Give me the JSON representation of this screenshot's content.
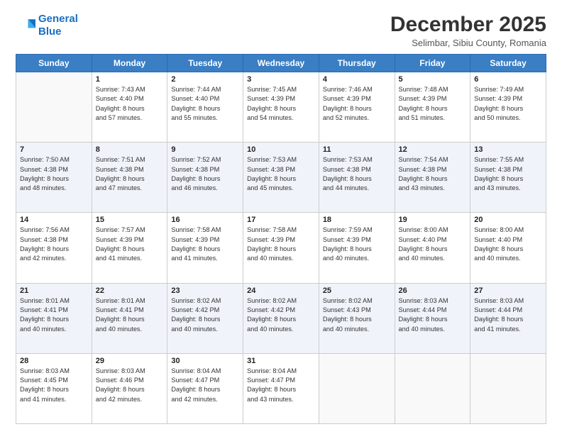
{
  "header": {
    "logo_line1": "General",
    "logo_line2": "Blue",
    "month_title": "December 2025",
    "location": "Selimbar, Sibiu County, Romania"
  },
  "days_of_week": [
    "Sunday",
    "Monday",
    "Tuesday",
    "Wednesday",
    "Thursday",
    "Friday",
    "Saturday"
  ],
  "weeks": [
    [
      {
        "day": "",
        "info": ""
      },
      {
        "day": "1",
        "info": "Sunrise: 7:43 AM\nSunset: 4:40 PM\nDaylight: 8 hours\nand 57 minutes."
      },
      {
        "day": "2",
        "info": "Sunrise: 7:44 AM\nSunset: 4:40 PM\nDaylight: 8 hours\nand 55 minutes."
      },
      {
        "day": "3",
        "info": "Sunrise: 7:45 AM\nSunset: 4:39 PM\nDaylight: 8 hours\nand 54 minutes."
      },
      {
        "day": "4",
        "info": "Sunrise: 7:46 AM\nSunset: 4:39 PM\nDaylight: 8 hours\nand 52 minutes."
      },
      {
        "day": "5",
        "info": "Sunrise: 7:48 AM\nSunset: 4:39 PM\nDaylight: 8 hours\nand 51 minutes."
      },
      {
        "day": "6",
        "info": "Sunrise: 7:49 AM\nSunset: 4:39 PM\nDaylight: 8 hours\nand 50 minutes."
      }
    ],
    [
      {
        "day": "7",
        "info": "Sunrise: 7:50 AM\nSunset: 4:38 PM\nDaylight: 8 hours\nand 48 minutes."
      },
      {
        "day": "8",
        "info": "Sunrise: 7:51 AM\nSunset: 4:38 PM\nDaylight: 8 hours\nand 47 minutes."
      },
      {
        "day": "9",
        "info": "Sunrise: 7:52 AM\nSunset: 4:38 PM\nDaylight: 8 hours\nand 46 minutes."
      },
      {
        "day": "10",
        "info": "Sunrise: 7:53 AM\nSunset: 4:38 PM\nDaylight: 8 hours\nand 45 minutes."
      },
      {
        "day": "11",
        "info": "Sunrise: 7:53 AM\nSunset: 4:38 PM\nDaylight: 8 hours\nand 44 minutes."
      },
      {
        "day": "12",
        "info": "Sunrise: 7:54 AM\nSunset: 4:38 PM\nDaylight: 8 hours\nand 43 minutes."
      },
      {
        "day": "13",
        "info": "Sunrise: 7:55 AM\nSunset: 4:38 PM\nDaylight: 8 hours\nand 43 minutes."
      }
    ],
    [
      {
        "day": "14",
        "info": "Sunrise: 7:56 AM\nSunset: 4:38 PM\nDaylight: 8 hours\nand 42 minutes."
      },
      {
        "day": "15",
        "info": "Sunrise: 7:57 AM\nSunset: 4:39 PM\nDaylight: 8 hours\nand 41 minutes."
      },
      {
        "day": "16",
        "info": "Sunrise: 7:58 AM\nSunset: 4:39 PM\nDaylight: 8 hours\nand 41 minutes."
      },
      {
        "day": "17",
        "info": "Sunrise: 7:58 AM\nSunset: 4:39 PM\nDaylight: 8 hours\nand 40 minutes."
      },
      {
        "day": "18",
        "info": "Sunrise: 7:59 AM\nSunset: 4:39 PM\nDaylight: 8 hours\nand 40 minutes."
      },
      {
        "day": "19",
        "info": "Sunrise: 8:00 AM\nSunset: 4:40 PM\nDaylight: 8 hours\nand 40 minutes."
      },
      {
        "day": "20",
        "info": "Sunrise: 8:00 AM\nSunset: 4:40 PM\nDaylight: 8 hours\nand 40 minutes."
      }
    ],
    [
      {
        "day": "21",
        "info": "Sunrise: 8:01 AM\nSunset: 4:41 PM\nDaylight: 8 hours\nand 40 minutes."
      },
      {
        "day": "22",
        "info": "Sunrise: 8:01 AM\nSunset: 4:41 PM\nDaylight: 8 hours\nand 40 minutes."
      },
      {
        "day": "23",
        "info": "Sunrise: 8:02 AM\nSunset: 4:42 PM\nDaylight: 8 hours\nand 40 minutes."
      },
      {
        "day": "24",
        "info": "Sunrise: 8:02 AM\nSunset: 4:42 PM\nDaylight: 8 hours\nand 40 minutes."
      },
      {
        "day": "25",
        "info": "Sunrise: 8:02 AM\nSunset: 4:43 PM\nDaylight: 8 hours\nand 40 minutes."
      },
      {
        "day": "26",
        "info": "Sunrise: 8:03 AM\nSunset: 4:44 PM\nDaylight: 8 hours\nand 40 minutes."
      },
      {
        "day": "27",
        "info": "Sunrise: 8:03 AM\nSunset: 4:44 PM\nDaylight: 8 hours\nand 41 minutes."
      }
    ],
    [
      {
        "day": "28",
        "info": "Sunrise: 8:03 AM\nSunset: 4:45 PM\nDaylight: 8 hours\nand 41 minutes."
      },
      {
        "day": "29",
        "info": "Sunrise: 8:03 AM\nSunset: 4:46 PM\nDaylight: 8 hours\nand 42 minutes."
      },
      {
        "day": "30",
        "info": "Sunrise: 8:04 AM\nSunset: 4:47 PM\nDaylight: 8 hours\nand 42 minutes."
      },
      {
        "day": "31",
        "info": "Sunrise: 8:04 AM\nSunset: 4:47 PM\nDaylight: 8 hours\nand 43 minutes."
      },
      {
        "day": "",
        "info": ""
      },
      {
        "day": "",
        "info": ""
      },
      {
        "day": "",
        "info": ""
      }
    ]
  ]
}
